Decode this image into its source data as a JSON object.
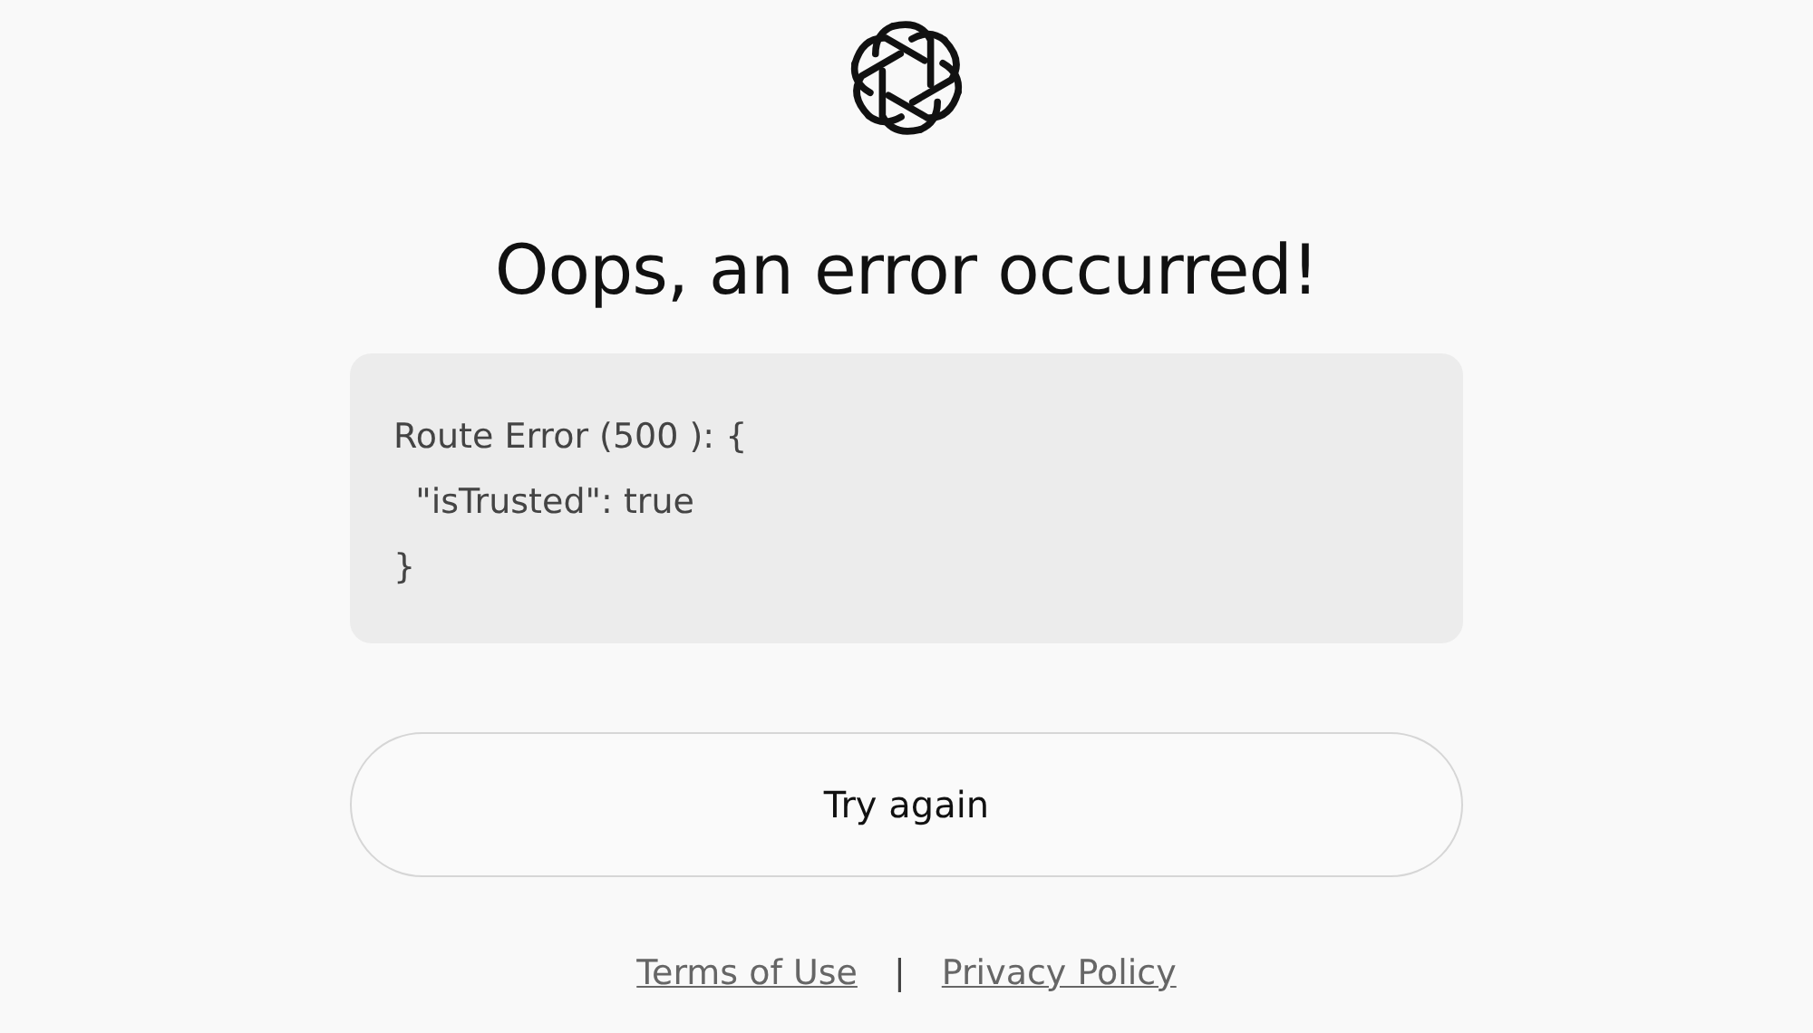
{
  "heading": "Oops, an error occurred!",
  "error_message": "Route Error (500 ): {\n  \"isTrusted\": true\n}",
  "button": "Try again",
  "footer_links": [
    "Terms of Use",
    "Privacy Policy"
  ],
  "separator": "|"
}
